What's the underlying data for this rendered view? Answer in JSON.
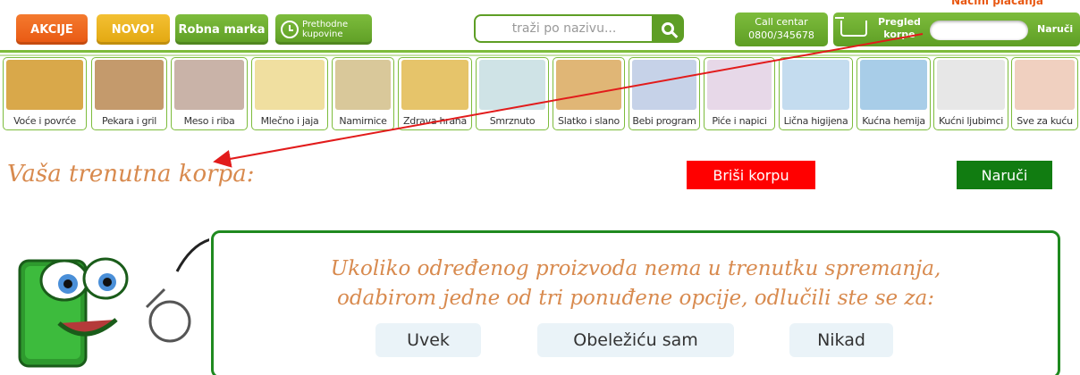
{
  "header": {
    "akcije": "AKCIJE",
    "novo": "NOVO!",
    "robna_marka": "Robna marka",
    "prethodne_1": "Prethodne",
    "prethodne_2": "kupovine",
    "search_placeholder": "traži po nazivu...",
    "call_center_label": "Call centar",
    "call_center_phone": "0800/345678",
    "cart_label_1": "Pregled",
    "cart_label_2": "korpe",
    "cart_naruci": "Naruči",
    "nacini_placanja": "Načini plaćanja"
  },
  "categories": [
    {
      "label": "Voće i povrće",
      "color": "#d9a84a",
      "icon": "fruit-vegetable-icon"
    },
    {
      "label": "Pekara i gril",
      "color": "#c49a6c",
      "icon": "bread-icon"
    },
    {
      "label": "Meso i riba",
      "color": "#c9b3a8",
      "icon": "meat-fish-icon"
    },
    {
      "label": "Mlečno i jaja",
      "color": "#f0dfa0",
      "icon": "dairy-eggs-icon"
    },
    {
      "label": "Namirnice",
      "color": "#d9c89a",
      "icon": "groceries-icon"
    },
    {
      "label": "Zdrava hrana",
      "color": "#e6c46a",
      "icon": "honey-icon"
    },
    {
      "label": "Smrznuto",
      "color": "#cfe3e6",
      "icon": "snowflake-icon"
    },
    {
      "label": "Slatko i slano",
      "color": "#e0b676",
      "icon": "cookies-icon"
    },
    {
      "label": "Bebi program",
      "color": "#c6d2e8",
      "icon": "baby-icon"
    },
    {
      "label": "Piće i napici",
      "color": "#e7d8e8",
      "icon": "drinks-icon"
    },
    {
      "label": "Lična higijena",
      "color": "#c4dcef",
      "icon": "toothbrush-icon"
    },
    {
      "label": "Kućna hemija",
      "color": "#a8cde8",
      "icon": "detergent-icon"
    },
    {
      "label": "Kućni ljubimci",
      "color": "#e7e7e7",
      "icon": "pet-icon"
    },
    {
      "label": "Sve za kuću",
      "color": "#f0d0c0",
      "icon": "house-icon"
    }
  ],
  "main": {
    "title": "Vaša trenutna korpa:",
    "brisi_korpu": "Briši korpu",
    "naruci": "Naruči",
    "question_line1": "Ukoliko određenog proizvoda nema u trenutku spremanja,",
    "question_line2": "odabirom jedne od tri ponuđene opcije, odlučili ste se za:",
    "options": [
      "Uvek",
      "Obeležiću sam",
      "Nikad"
    ]
  },
  "colors": {
    "accent_green": "#5e9e25",
    "orange": "#e85812",
    "title_orange": "#d88a4e",
    "delete_red": "#ff0000",
    "order_green": "#117c11"
  }
}
